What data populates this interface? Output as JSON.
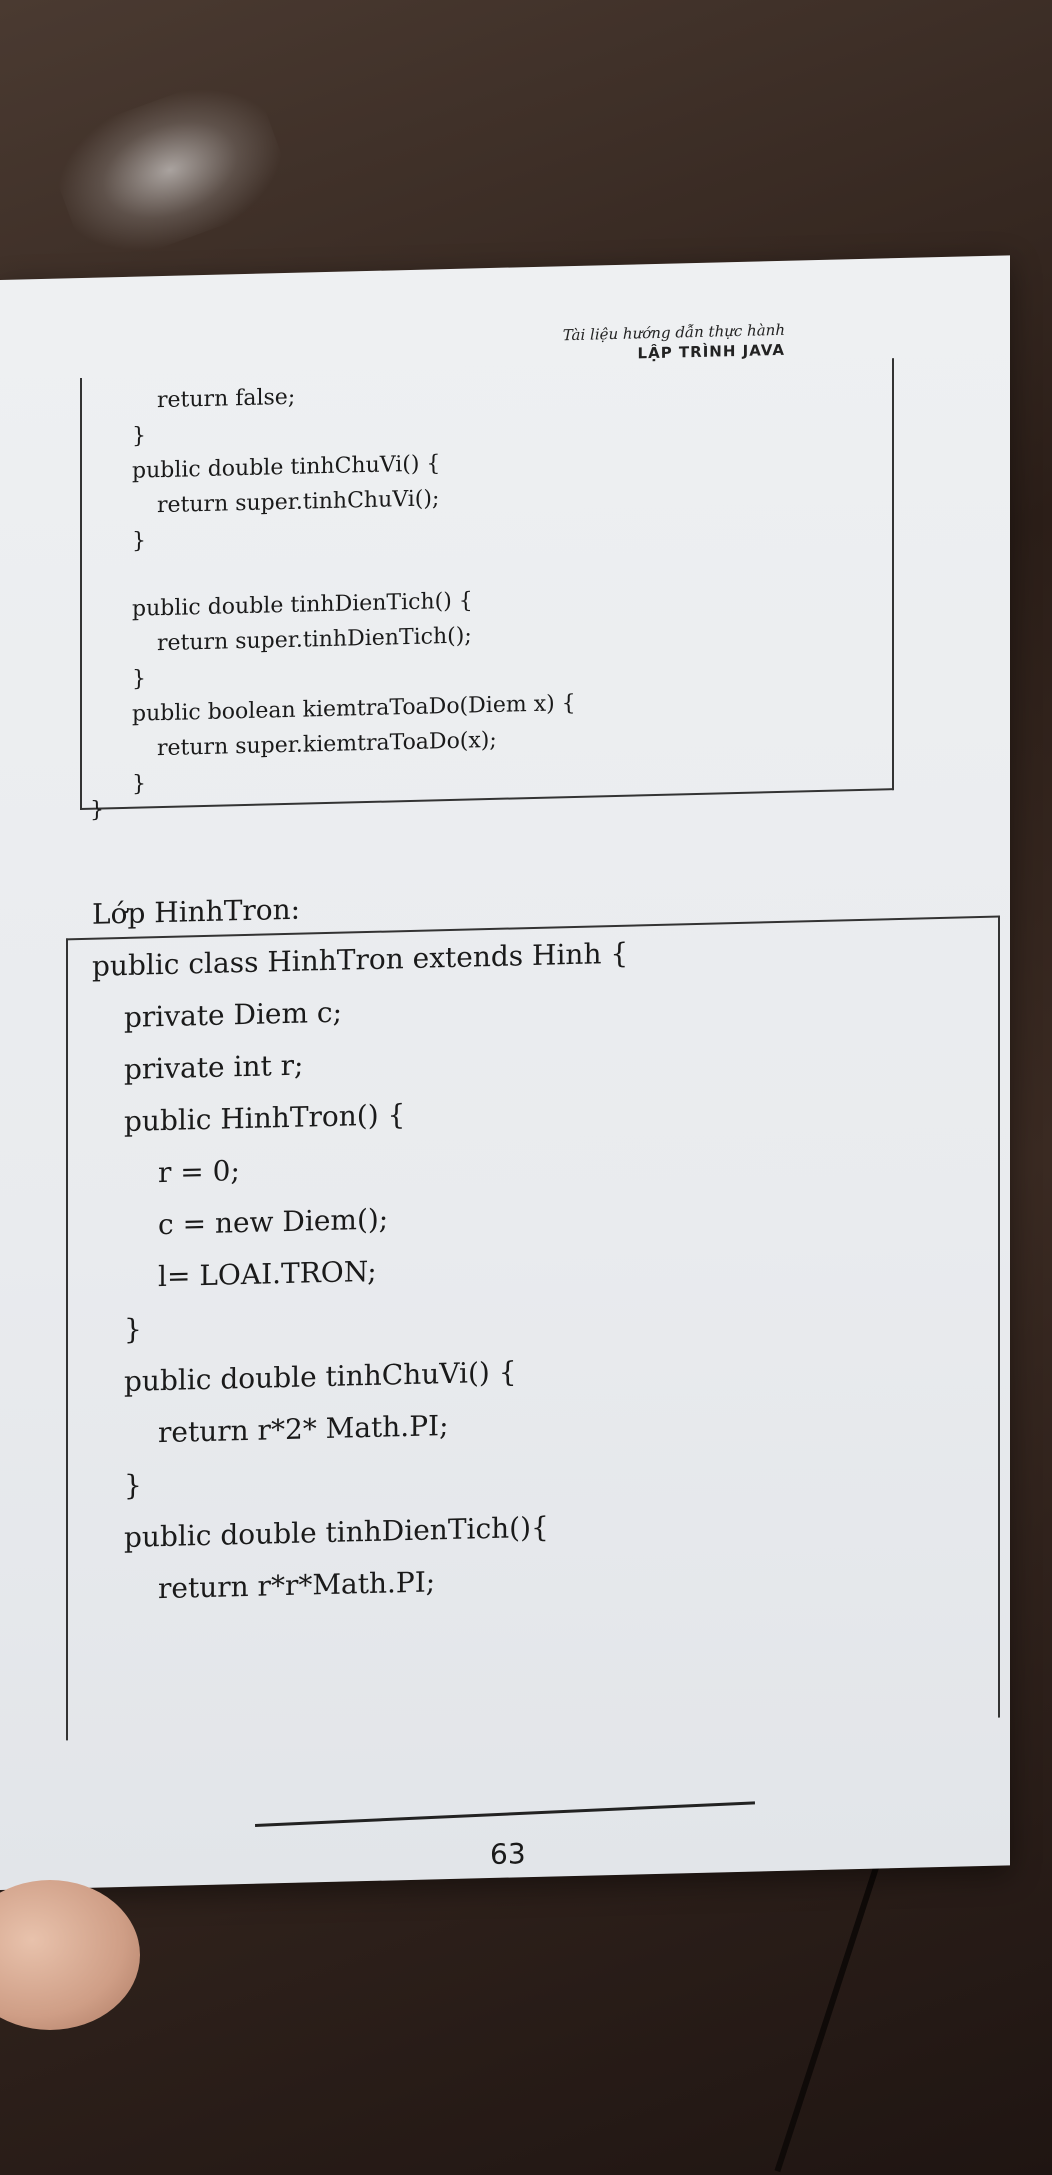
{
  "header": {
    "subtitle": "Tài liệu hướng dẫn thực hành",
    "title": "LẬP TRÌNH JAVA"
  },
  "code_top": [
    "return false;",
    "}",
    "public double tinhChuVi() {",
    "return super.tinhChuVi();",
    "}",
    "public double tinhDienTich() {",
    "return super.tinhDienTich();",
    "}",
    "public boolean kiemtraToaDo(Diem x) {",
    "return super.kiemtraToaDo(x);",
    "}",
    "}"
  ],
  "section_label": "Lớp HinhTron:",
  "code_bottom": [
    "public class HinhTron extends Hinh {",
    "private Diem c;",
    "private int r;",
    "public HinhTron() {",
    "r = 0;",
    "c = new Diem();",
    "l= LOAI.TRON;",
    "}",
    "public double tinhChuVi() {",
    "return r*2* Math.PI;",
    "}",
    "public double tinhDienTich(){",
    "return r*r*Math.PI;"
  ],
  "page_number": "63"
}
